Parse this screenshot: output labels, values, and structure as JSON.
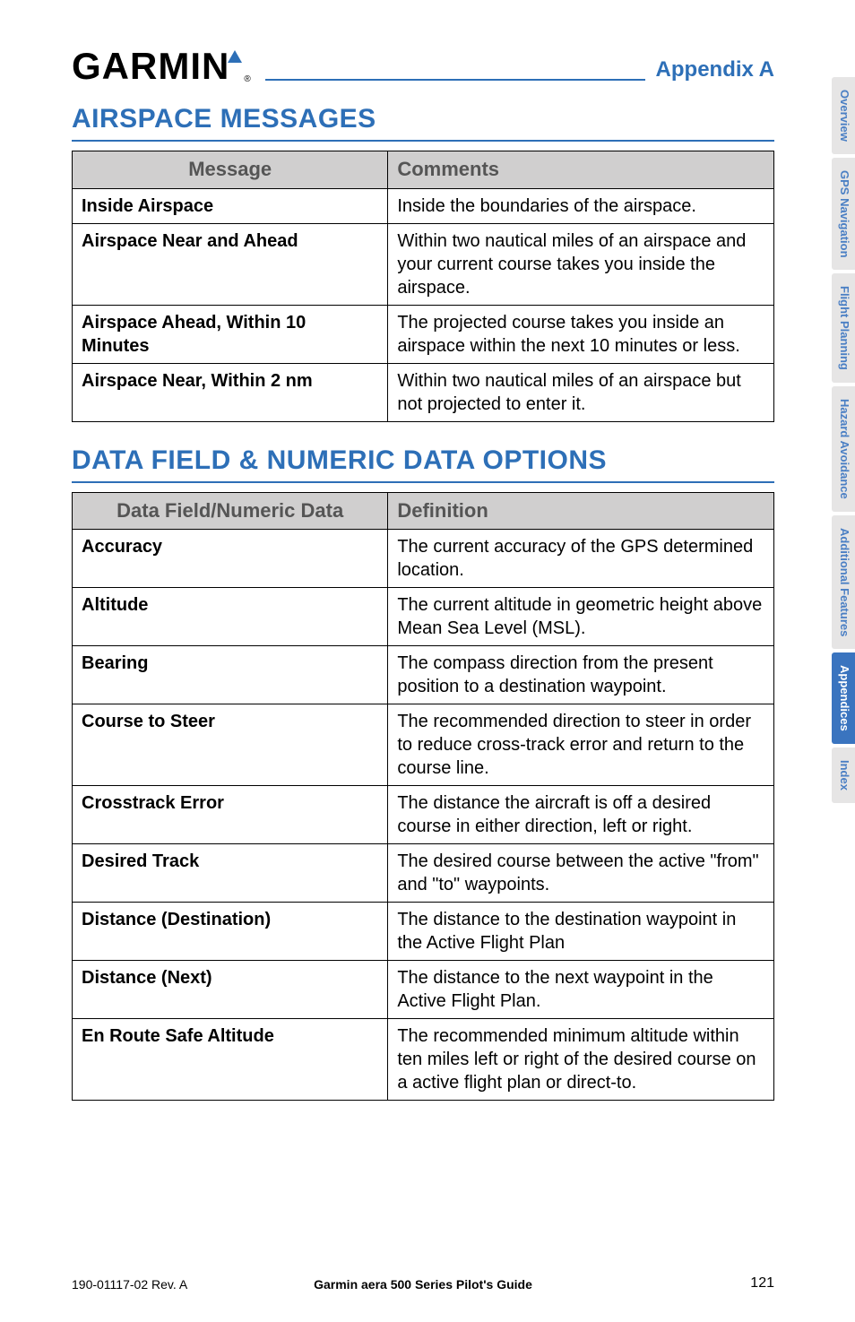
{
  "header": {
    "brand": "GARMIN",
    "appendix": "Appendix A"
  },
  "sections": {
    "airspace": {
      "heading": "AIRSPACE MESSAGES",
      "col1": "Message",
      "col2": "Comments",
      "rows": [
        {
          "label": "Inside Airspace",
          "def": "Inside the boundaries of the airspace."
        },
        {
          "label": "Airspace Near and Ahead",
          "def": "Within two nautical miles of an airspace and your current course takes you inside the airspace."
        },
        {
          "label": "Airspace Ahead, Within 10 Minutes",
          "def": "The projected course takes you inside an airspace within the next 10 minutes or less."
        },
        {
          "label": "Airspace Near, Within 2 nm",
          "def": "Within two nautical miles of an airspace but not projected to enter it."
        }
      ]
    },
    "datafields": {
      "heading": "DATA FIELD & NUMERIC DATA OPTIONS",
      "col1": "Data Field/Numeric Data",
      "col2": "Definition",
      "rows": [
        {
          "label": "Accuracy",
          "def": "The current accuracy of the GPS determined location."
        },
        {
          "label": "Altitude",
          "def": "The current altitude in geometric height above Mean Sea Level (MSL)."
        },
        {
          "label": "Bearing",
          "def": "The compass direction from the present position to a destination waypoint."
        },
        {
          "label": "Course to Steer",
          "def": "The recommended direction to steer in order to reduce cross-track error and return to the course line."
        },
        {
          "label": "Crosstrack Error",
          "def": "The distance the aircraft is off a desired course in either direction, left or right."
        },
        {
          "label": "Desired Track",
          "def": "The desired course between the active \"from\" and \"to\" waypoints."
        },
        {
          "label": "Distance (Destination)",
          "def": "The distance to the destination waypoint in the Active Flight Plan"
        },
        {
          "label": "Distance (Next)",
          "def": "The distance to the next waypoint in the Active Flight Plan."
        },
        {
          "label": "En Route Safe Altitude",
          "def": "The recommended minimum altitude within ten miles left or right of the desired course on a active flight plan or direct-to."
        }
      ]
    }
  },
  "tabs": [
    {
      "label": "Overview",
      "active": false
    },
    {
      "label": "GPS Navigation",
      "active": false
    },
    {
      "label": "Flight Planning",
      "active": false
    },
    {
      "label": "Hazard Avoidance",
      "active": false
    },
    {
      "label": "Additional Features",
      "active": false
    },
    {
      "label": "Appendices",
      "active": true
    },
    {
      "label": "Index",
      "active": false
    }
  ],
  "footer": {
    "left": "190-01117-02 Rev. A",
    "center": "Garmin aera 500 Series Pilot's Guide",
    "right": "121"
  }
}
